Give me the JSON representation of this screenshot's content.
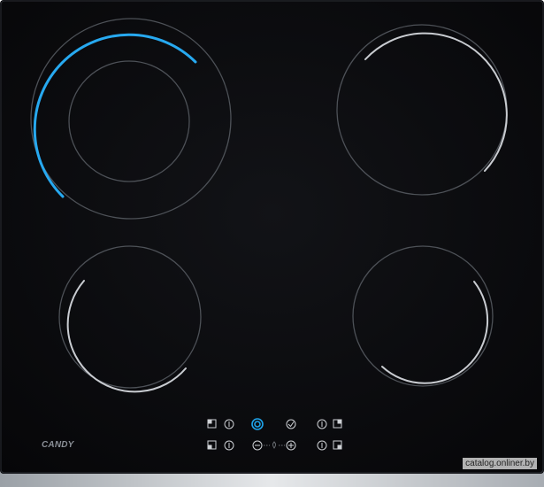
{
  "brand": "CANDY",
  "watermark": "catalog.onliner.by",
  "colors": {
    "glass": "#0b0c0f",
    "zone_outline": "#4d5157",
    "active_arc": "#27a9f0",
    "inactive_arc": "#c9ccd1",
    "frame": "#cfd3d8",
    "control_symbol": "#cfd2d6",
    "power_key": "#1ea3ea"
  },
  "zones": [
    {
      "name": "front-left-large-dual",
      "state": "active"
    },
    {
      "name": "rear-right",
      "state": "inactive"
    },
    {
      "name": "front-left-small",
      "state": "inactive"
    },
    {
      "name": "front-right-small",
      "state": "inactive"
    }
  ],
  "controls": [
    {
      "icon": "zone-select-top-left-icon"
    },
    {
      "icon": "zone-on-top-left-icon"
    },
    {
      "icon": "power-icon",
      "highlighted": true
    },
    {
      "icon": "lock-icon"
    },
    {
      "icon": "zone-on-top-right-icon"
    },
    {
      "icon": "zone-select-top-right-icon"
    },
    {
      "icon": "zone-select-bottom-left-icon"
    },
    {
      "icon": "zone-on-bottom-left-icon"
    },
    {
      "icon": "minus-icon"
    },
    {
      "icon": "heat-level-icon"
    },
    {
      "icon": "plus-icon"
    },
    {
      "icon": "zone-on-bottom-right-icon"
    },
    {
      "icon": "zone-select-bottom-right-icon"
    }
  ]
}
